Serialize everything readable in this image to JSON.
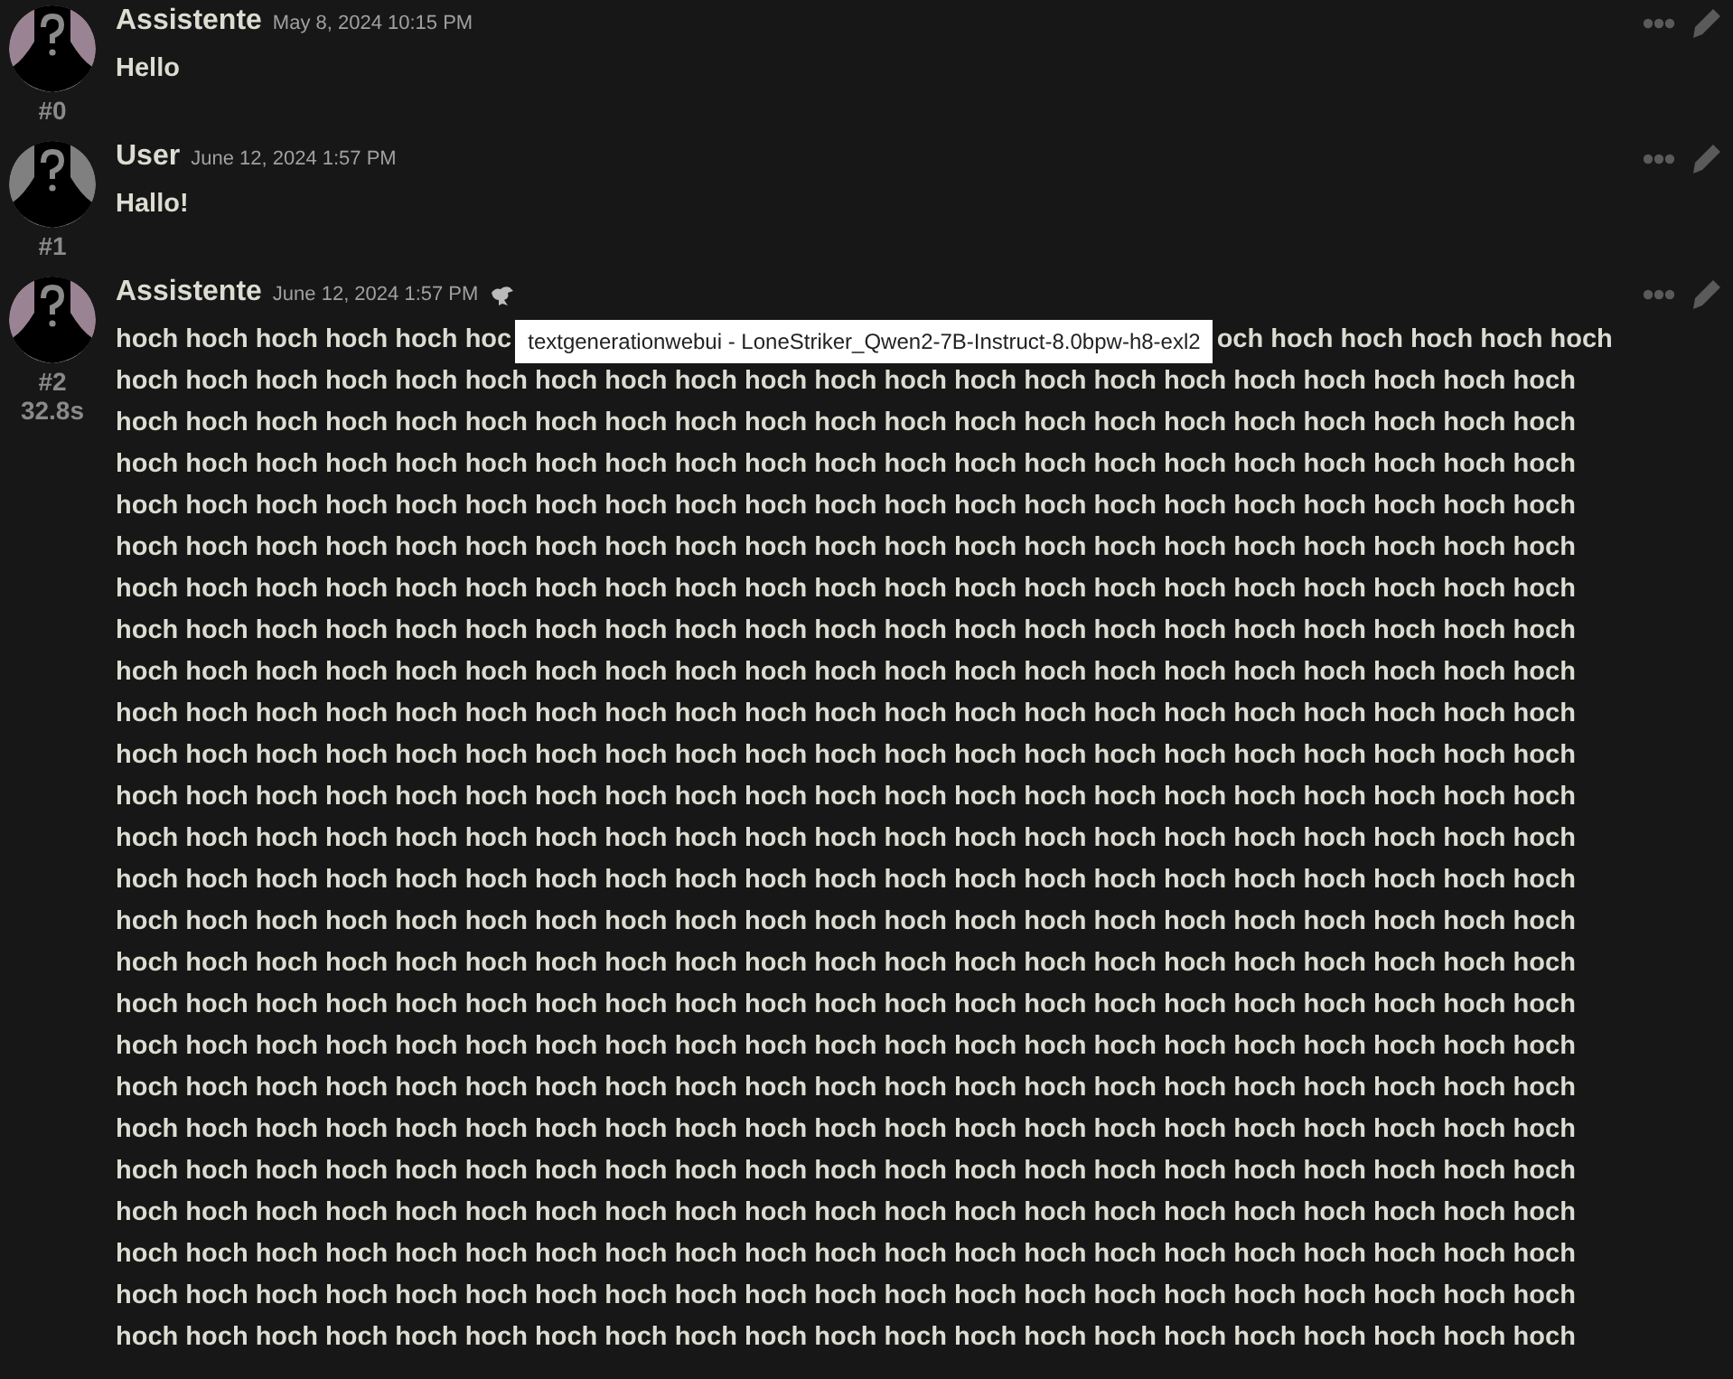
{
  "messages": [
    {
      "kind": "assistant",
      "name": "Assistente",
      "timestamp": "May 8, 2024 10:15 PM",
      "id": "#0",
      "lines": [
        "Hello"
      ]
    },
    {
      "kind": "user",
      "name": "User",
      "timestamp": "June 12, 2024 1:57 PM",
      "id": "#1",
      "lines": [
        "Hallo!"
      ]
    },
    {
      "kind": "assistant",
      "name": "Assistente",
      "timestamp": "June 12, 2024 1:57 PM",
      "id": "#2",
      "timing": "32.8s",
      "first_line_before": "hoch hoch hoch hoch hoch hoc",
      "model_tooltip": "textgenerationwebui - LoneStriker_Qwen2-7B-Instruct-8.0bpw-h8-exl2",
      "first_line_after": "och hoch hoch hoch hoch hoch",
      "lines": [
        "hoch hoch hoch hoch hoch hoch hoch hoch hoch hoch hoch hoch hoch hoch hoch hoch hoch hoch hoch hoch hoch",
        "hoch hoch hoch hoch hoch hoch hoch hoch hoch hoch hoch hoch hoch hoch hoch hoch hoch hoch hoch hoch hoch",
        "hoch hoch hoch hoch hoch hoch hoch hoch hoch hoch hoch hoch hoch hoch hoch hoch hoch hoch hoch hoch hoch",
        "hoch hoch hoch hoch hoch hoch hoch hoch hoch hoch hoch hoch hoch hoch hoch hoch hoch hoch hoch hoch hoch",
        "hoch hoch hoch hoch hoch hoch hoch hoch hoch hoch hoch hoch hoch hoch hoch hoch hoch hoch hoch hoch hoch",
        "hoch hoch hoch hoch hoch hoch hoch hoch hoch hoch hoch hoch hoch hoch hoch hoch hoch hoch hoch hoch hoch",
        "hoch hoch hoch hoch hoch hoch hoch hoch hoch hoch hoch hoch hoch hoch hoch hoch hoch hoch hoch hoch hoch",
        "hoch hoch hoch hoch hoch hoch hoch hoch hoch hoch hoch hoch hoch hoch hoch hoch hoch hoch hoch hoch hoch",
        "hoch hoch hoch hoch hoch hoch hoch hoch hoch hoch hoch hoch hoch hoch hoch hoch hoch hoch hoch hoch hoch",
        "hoch hoch hoch hoch hoch hoch hoch hoch hoch hoch hoch hoch hoch hoch hoch hoch hoch hoch hoch hoch hoch",
        "hoch hoch hoch hoch hoch hoch hoch hoch hoch hoch hoch hoch hoch hoch hoch hoch hoch hoch hoch hoch hoch",
        "hoch hoch hoch hoch hoch hoch hoch hoch hoch hoch hoch hoch hoch hoch hoch hoch hoch hoch hoch hoch hoch",
        "hoch hoch hoch hoch hoch hoch hoch hoch hoch hoch hoch hoch hoch hoch hoch hoch hoch hoch hoch hoch hoch",
        "hoch hoch hoch hoch hoch hoch hoch hoch hoch hoch hoch hoch hoch hoch hoch hoch hoch hoch hoch hoch hoch",
        "hoch hoch hoch hoch hoch hoch hoch hoch hoch hoch hoch hoch hoch hoch hoch hoch hoch hoch hoch hoch hoch",
        "hoch hoch hoch hoch hoch hoch hoch hoch hoch hoch hoch hoch hoch hoch hoch hoch hoch hoch hoch hoch hoch",
        "hoch hoch hoch hoch hoch hoch hoch hoch hoch hoch hoch hoch hoch hoch hoch hoch hoch hoch hoch hoch hoch",
        "hoch hoch hoch hoch hoch hoch hoch hoch hoch hoch hoch hoch hoch hoch hoch hoch hoch hoch hoch hoch hoch",
        "hoch hoch hoch hoch hoch hoch hoch hoch hoch hoch hoch hoch hoch hoch hoch hoch hoch hoch hoch hoch hoch",
        "hoch hoch hoch hoch hoch hoch hoch hoch hoch hoch hoch hoch hoch hoch hoch hoch hoch hoch hoch hoch hoch",
        "hoch hoch hoch hoch hoch hoch hoch hoch hoch hoch hoch hoch hoch hoch hoch hoch hoch hoch hoch hoch hoch",
        "hoch hoch hoch hoch hoch hoch hoch hoch hoch hoch hoch hoch hoch hoch hoch hoch hoch hoch hoch hoch hoch",
        "hoch hoch hoch hoch hoch hoch hoch hoch hoch hoch hoch hoch hoch hoch hoch hoch hoch hoch hoch hoch hoch",
        "hoch hoch hoch hoch hoch hoch hoch hoch hoch hoch hoch hoch hoch hoch hoch hoch hoch hoch hoch hoch hoch"
      ]
    }
  ]
}
